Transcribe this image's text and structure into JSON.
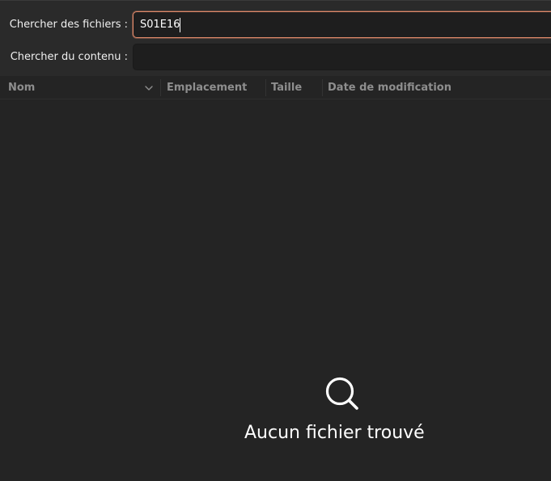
{
  "search": {
    "files_label": "Chercher des fichiers :",
    "files_value": "S01E16",
    "content_label": "Chercher du contenu :",
    "content_value": ""
  },
  "columns": [
    {
      "label": "Nom",
      "sorted": true,
      "sort_icon": "chevron-down-icon"
    },
    {
      "label": "Emplacement"
    },
    {
      "label": "Taille"
    },
    {
      "label": "Date de modification"
    }
  ],
  "empty_state": {
    "icon": "search-icon",
    "message": "Aucun fichier trouvé"
  },
  "colors": {
    "background": "#242424",
    "panel": "#2a2a2a",
    "field_background": "#1e1e1e",
    "focus_accent": "#e0896a",
    "header_text": "#8e8e8e"
  }
}
